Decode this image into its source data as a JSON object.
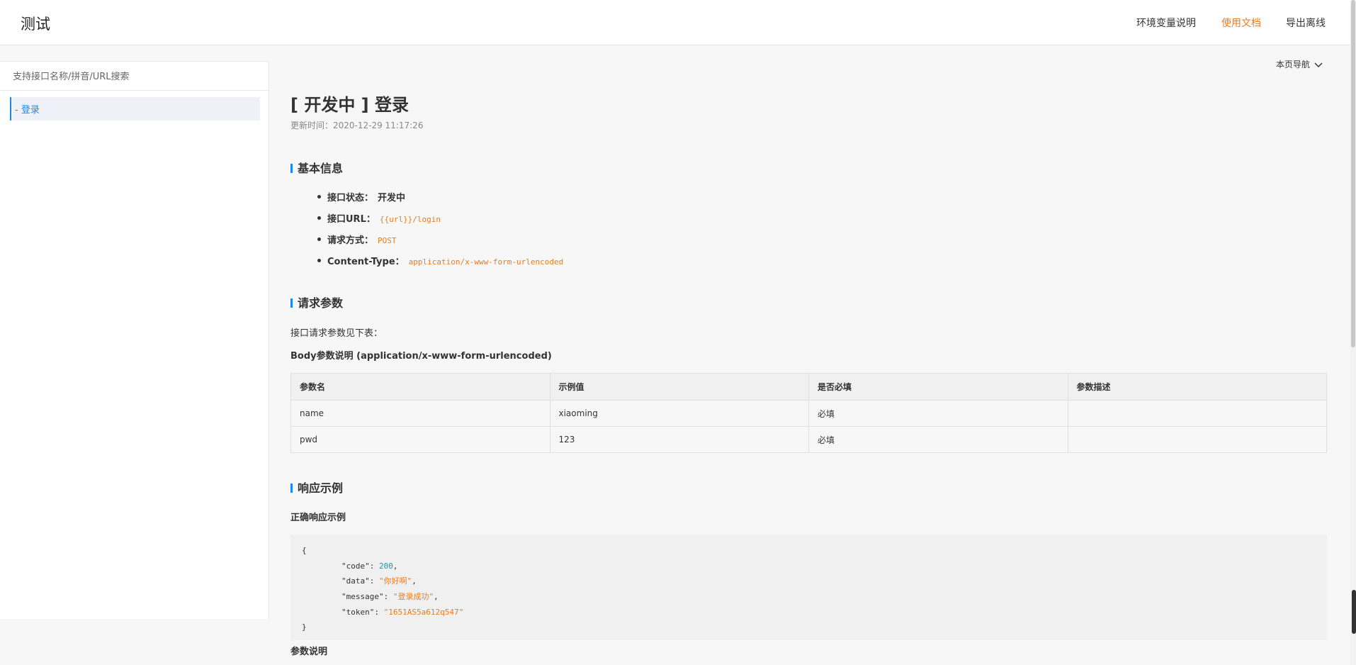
{
  "header": {
    "title": "测试",
    "nav": [
      {
        "label": "环境变量说明"
      },
      {
        "label": "使用文档"
      },
      {
        "label": "导出离线"
      }
    ]
  },
  "sidebar": {
    "search_placeholder": "支持接口名称/拼音/URL搜索",
    "items": [
      {
        "label": "- 登录"
      }
    ]
  },
  "page_nav": {
    "label": "本页导航",
    "icon": "chevron-down-icon"
  },
  "doc": {
    "title": "[ 开发中 ] 登录",
    "updated": "更新时间：2020-12-29 11:17:26",
    "sections": {
      "basic": "基本信息",
      "request": "请求参数",
      "response": "响应示例"
    },
    "info": [
      {
        "key": "接口状态：",
        "value": "开发中"
      },
      {
        "key": "接口URL：",
        "value": "{{url}}/login"
      },
      {
        "key": "请求方式：",
        "value": "POST"
      },
      {
        "key": "Content-Type：",
        "value": "application/x-www-form-urlencoded"
      }
    ],
    "request_intro": "接口请求参数见下表：",
    "body_title": "Body参数说明 (application/x-www-form-urlencoded)",
    "table": {
      "headers": [
        "参数名",
        "示例值",
        "是否必填",
        "参数描述"
      ],
      "rows": [
        [
          "name",
          "xiaoming",
          "必填",
          ""
        ],
        [
          "pwd",
          "123",
          "必填",
          ""
        ]
      ]
    },
    "response_title": "正确响应示例",
    "response_code": {
      "open": "{",
      "close": "}",
      "fields": [
        {
          "key": "\"code\"",
          "value": "200"
        },
        {
          "key": "\"data\"",
          "value": "\"你好啊\""
        },
        {
          "key": "\"message\"",
          "value": "\"登录成功\""
        },
        {
          "key": "\"token\"",
          "value": "\"1651AS5a612q547\""
        }
      ]
    },
    "params_desc_title": "参数说明"
  }
}
